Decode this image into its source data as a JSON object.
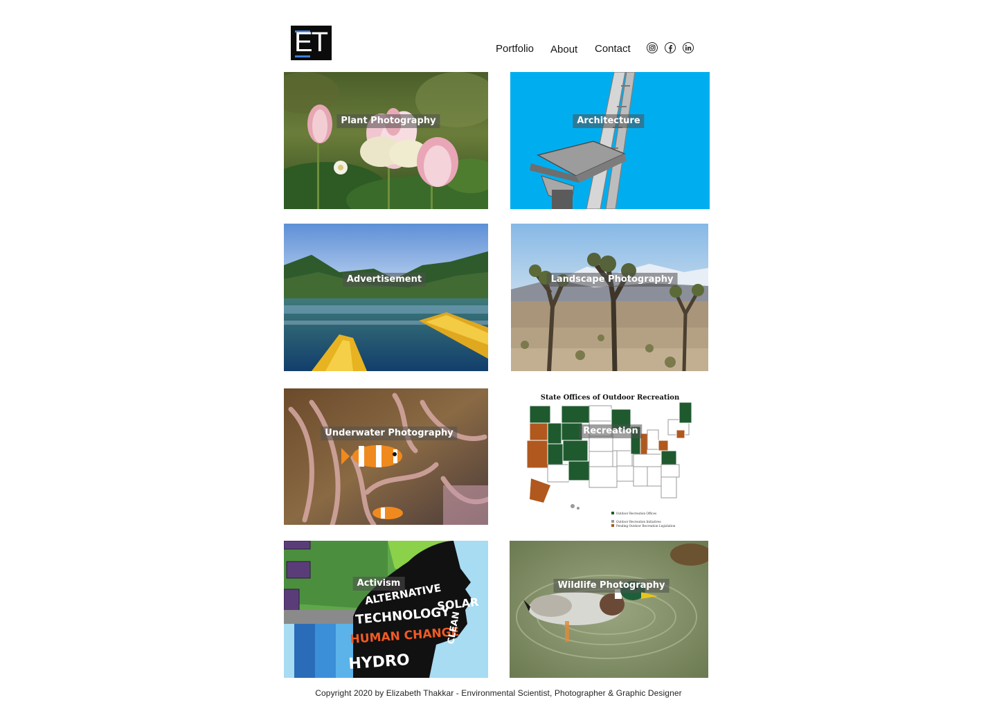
{
  "brand": {
    "logo_text": "ET"
  },
  "nav": {
    "items": [
      {
        "label": "Portfolio"
      },
      {
        "label": "About"
      },
      {
        "label": "Contact"
      }
    ],
    "social": [
      "instagram-icon",
      "facebook-icon",
      "linkedin-icon"
    ]
  },
  "tiles": [
    {
      "label": "Plant Photography"
    },
    {
      "label": "Architecture"
    },
    {
      "label": "Advertisement"
    },
    {
      "label": "Landscape Photography"
    },
    {
      "label": "Underwater Photography"
    },
    {
      "label": "Recreation"
    },
    {
      "label": "Activism"
    },
    {
      "label": "Wildlife Photography"
    }
  ],
  "recreation_map": {
    "title": "State Offices of Outdoor Recreation",
    "legend": [
      "Outdoor Recreation Offices",
      "Outdoor Recreation Initiatives",
      "Pending Outdoor Recreation Legislation"
    ]
  },
  "activism_art": {
    "words": [
      "ALTERNATIVE",
      "TECHNOLOGY",
      "HUMAN CHANGE",
      "HYDRO",
      "SOLAR",
      "CLEAN"
    ]
  },
  "footer": {
    "copyright": "Copyright 2020 by Elizabeth Thakkar - Environmental Scientist, Photographer & Graphic Designer"
  },
  "colors": {
    "sky_blue": "#00aeef",
    "map_green": "#1f5a2f",
    "map_orange": "#b0581e",
    "label_bg": "#505050"
  }
}
